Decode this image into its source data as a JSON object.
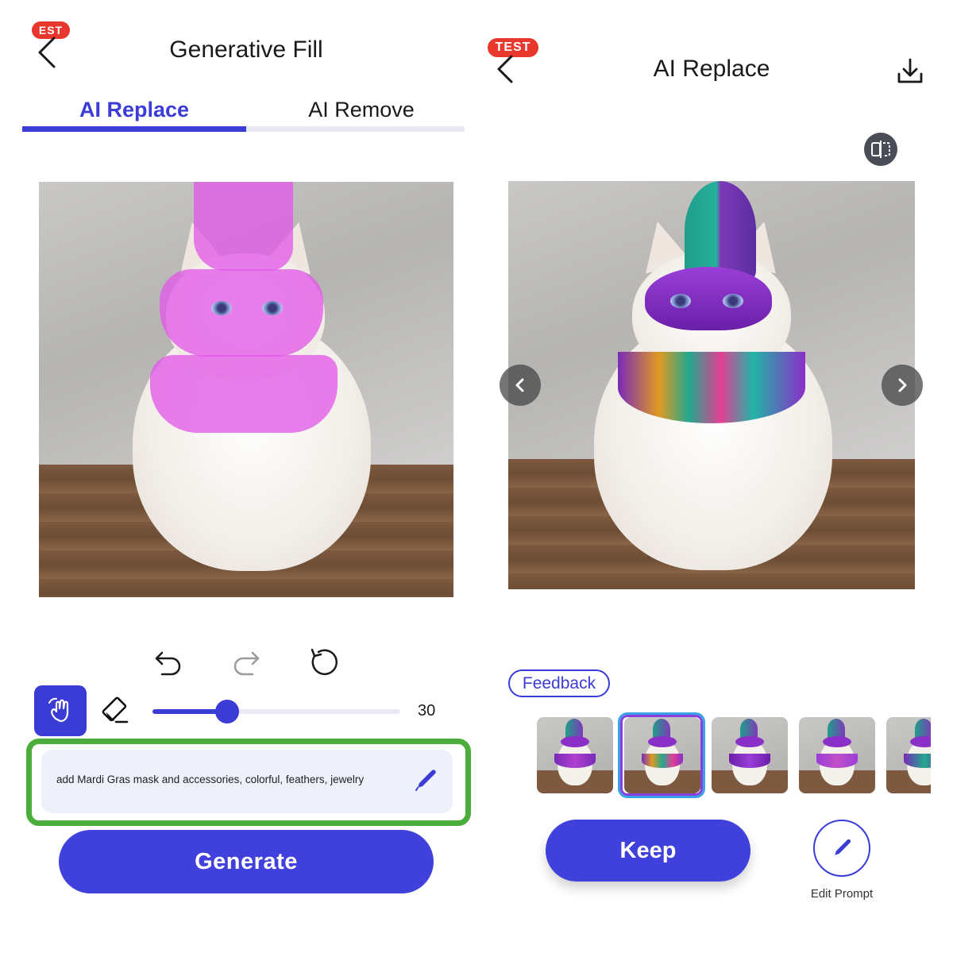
{
  "left_screen": {
    "badge": "EST",
    "title": "Generative Fill",
    "tabs": [
      {
        "label": "AI Replace",
        "active": true
      },
      {
        "label": "AI Remove",
        "active": false
      }
    ],
    "brush_size": "30",
    "brush_size_fraction": 0.3,
    "prompt_text": "add Mardi Gras mask and accessories, colorful, feathers, jewelry",
    "generate_label": "Generate",
    "icons": [
      "back-icon",
      "undo-icon",
      "redo-icon",
      "reset-icon",
      "brush-hand-icon",
      "eraser-icon",
      "pen-icon"
    ]
  },
  "right_screen": {
    "badge": "TEST",
    "title": "AI Replace",
    "feedback_label": "Feedback",
    "thumbnail_count": 5,
    "selected_thumbnail": 2,
    "keep_label": "Keep",
    "edit_prompt_label": "Edit Prompt",
    "icons": [
      "back-icon",
      "download-icon",
      "compare-icon",
      "prev-arrow-icon",
      "next-arrow-icon",
      "pen-icon"
    ]
  },
  "colors": {
    "accent": "#4040dc",
    "mask": "#e25ae8",
    "highlight": "#4cae3a",
    "badge": "#e8372c"
  }
}
